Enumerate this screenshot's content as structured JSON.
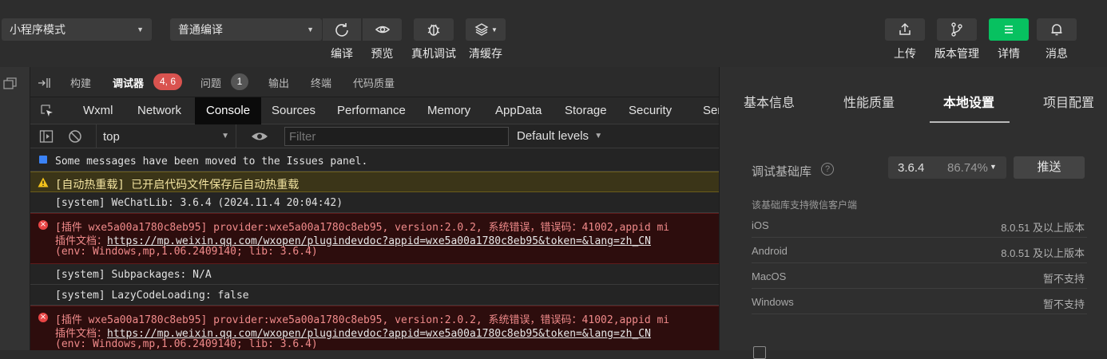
{
  "toolbar": {
    "mode_select": "小程序模式",
    "compile_select": "普通编译",
    "labels": {
      "compile": "编译",
      "preview": "预览",
      "debug": "真机调试",
      "clear_cache": "清缓存",
      "upload": "上传",
      "version": "版本管理",
      "details": "详情",
      "messages": "消息"
    },
    "accent": "#07c160"
  },
  "panel_tabs": {
    "build": "构建",
    "debugger": "调试器",
    "debugger_badge": "4, 6",
    "issues": "问题",
    "issues_badge": "1",
    "output": "输出",
    "terminal": "终端",
    "code_quality": "代码质量"
  },
  "devtools_tabs": [
    "Wxml",
    "Network",
    "Console",
    "Sources",
    "Performance",
    "Memory",
    "AppData",
    "Storage",
    "Security",
    "Sen"
  ],
  "console_bar": {
    "context": "top",
    "filter_placeholder": "Filter",
    "levels": "Default levels"
  },
  "log": {
    "info1": "Some messages have been moved to the Issues panel.",
    "warn1": "[自动热重载] 已开启代码文件保存后自动热重载",
    "sys1": "[system] WeChatLib: 3.6.4 (2024.11.4 20:04:42)",
    "err1_line1": "[插件 wxe5a00a1780c8eb95] provider:wxe5a00a1780c8eb95, version:2.0.2, 系统错误，错误码：41002,appid mi",
    "err1_prefix": "插件文档：",
    "err1_link": "https://mp.weixin.qq.com/wxopen/plugindevdoc?appid=wxe5a00a1780c8eb95&token=&lang=zh_CN",
    "err1_env": "(env: Windows,mp,1.06.2409140; lib: 3.6.4)",
    "sys2": "[system] Subpackages: N/A",
    "sys3": "[system] LazyCodeLoading: false",
    "err2_line1": "[插件 wxe5a00a1780c8eb95] provider:wxe5a00a1780c8eb95, version:2.0.2, 系统错误，错误码：41002,appid mi",
    "err2_prefix": "插件文档：",
    "err2_link": "https://mp.weixin.qq.com/wxopen/plugindevdoc?appid=wxe5a00a1780c8eb95&token=&lang=zh_CN",
    "err2_env": "(env: Windows,mp,1.06.2409140; lib: 3.6.4)"
  },
  "right_panel": {
    "tabs": [
      "基本信息",
      "性能质量",
      "本地设置",
      "项目配置"
    ],
    "active_tab": "本地设置",
    "lib_label": "调试基础库",
    "lib_version": "3.6.4",
    "lib_percent": "86.74%",
    "push_button": "推送",
    "support_heading": "该基础库支持微信客户端",
    "platforms": [
      {
        "name": "iOS",
        "value": "8.0.51 及以上版本"
      },
      {
        "name": "Android",
        "value": "8.0.51 及以上版本"
      },
      {
        "name": "MacOS",
        "value": "暂不支持"
      },
      {
        "name": "Windows",
        "value": "暂不支持"
      }
    ]
  }
}
